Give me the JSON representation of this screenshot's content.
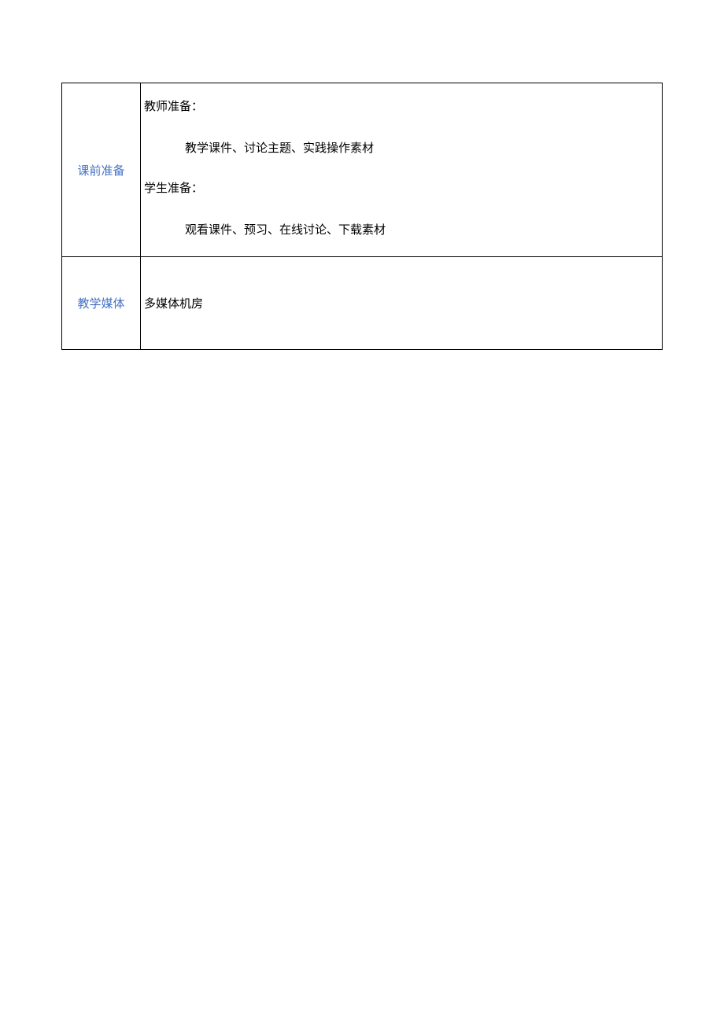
{
  "rows": [
    {
      "label": "课前准备",
      "teacher_prep_label": "教师准备：",
      "teacher_prep_content": "教学课件、讨论主题、实践操作素材",
      "student_prep_label": "学生准备：",
      "student_prep_content": "观看课件、预习、在线讨论、下载素材"
    },
    {
      "label": "教学媒体",
      "content": "多媒体机房"
    }
  ]
}
